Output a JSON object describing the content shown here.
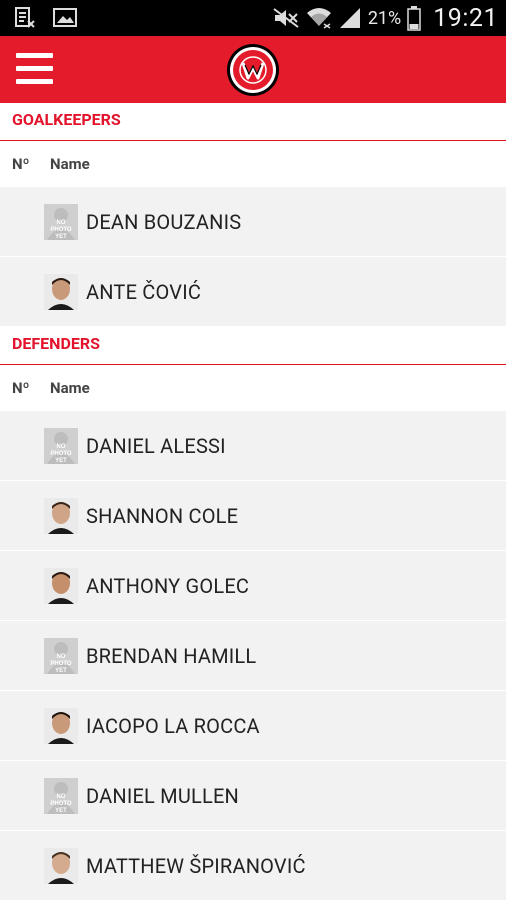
{
  "status_bar": {
    "battery_percent": "21%",
    "time": "19:21",
    "icons": [
      "notification-screenshot-icon",
      "image-icon",
      "mute-icon",
      "wifi-icon",
      "signal-icon",
      "battery-icon"
    ]
  },
  "app_bar": {
    "menu_icon": "hamburger-menu-icon",
    "logo": "western-sydney-wanderers-logo",
    "accent_color": "#e41b2a"
  },
  "sections": [
    {
      "title": "GOALKEEPERS",
      "header": {
        "number": "Nº",
        "name": "Name"
      },
      "players": [
        {
          "name": "DEAN BOUZANIS",
          "photo": "no-photo"
        },
        {
          "name": "ANTE ČOVIĆ",
          "photo": "headshot"
        }
      ]
    },
    {
      "title": "DEFENDERS",
      "header": {
        "number": "Nº",
        "name": "Name"
      },
      "players": [
        {
          "name": "DANIEL ALESSI",
          "photo": "no-photo"
        },
        {
          "name": "SHANNON COLE",
          "photo": "headshot"
        },
        {
          "name": "ANTHONY GOLEC",
          "photo": "headshot"
        },
        {
          "name": "BRENDAN HAMILL",
          "photo": "no-photo"
        },
        {
          "name": "IACOPO LA ROCCA",
          "photo": "headshot"
        },
        {
          "name": "DANIEL MULLEN",
          "photo": "no-photo"
        },
        {
          "name": "MATTHEW ŠPIRANOVIĆ",
          "photo": "headshot"
        }
      ]
    }
  ]
}
